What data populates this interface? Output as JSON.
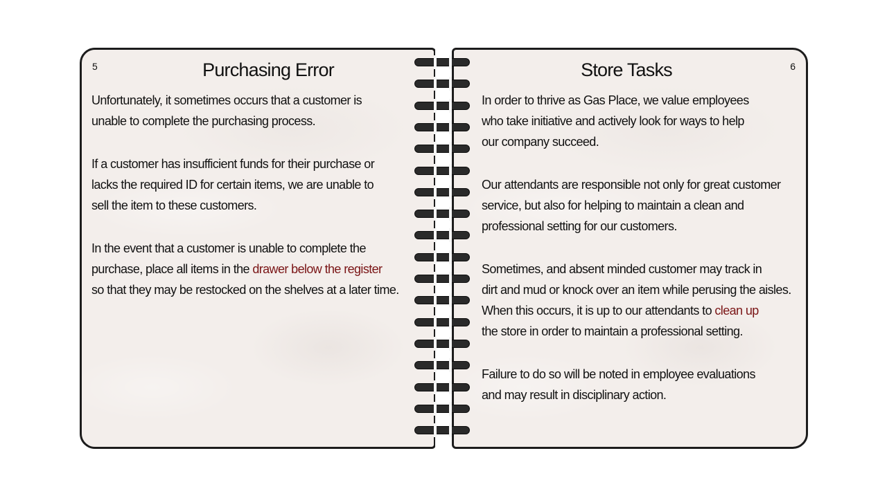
{
  "left_page": {
    "number": "5",
    "title": "Purchasing Error",
    "paragraphs": [
      {
        "lines": [
          "Unfortunately, it sometimes occurs that a customer is",
          "unable to complete the purchasing process."
        ]
      },
      {
        "lines": [
          "If a customer has insufficient funds for their purchase or",
          "lacks the required ID for certain items, we are unable to",
          "sell the item to these customers."
        ]
      },
      {
        "line1": "In the event that a customer is unable to complete the",
        "line2_before": "purchase, place all items in the ",
        "line2_highlight": "drawer below the register",
        "line3": "so that they may be restocked on the shelves at a later time."
      }
    ]
  },
  "right_page": {
    "number": "6",
    "title": "Store Tasks",
    "paragraphs": [
      {
        "lines": [
          "In order to thrive as Gas Place, we value employees",
          "who take initiative and actively look for ways to help",
          "our company succeed."
        ]
      },
      {
        "lines": [
          "Our attendants are responsible not only for great customer",
          "service, but also for helping to maintain a clean and",
          "professional setting for our customers."
        ]
      },
      {
        "line1": "Sometimes, and absent minded customer may track in",
        "line2": "dirt and mud or knock over an item while perusing the aisles.",
        "line3_before": "When this occurs, it is up to our attendants to ",
        "line3_highlight": "clean up",
        "line4": "the store in order to maintain a professional setting."
      },
      {
        "lines": [
          "Failure to do so will be noted in employee evaluations",
          "and may result in disciplinary action."
        ]
      }
    ]
  },
  "colors": {
    "page_background": "#f3eeeb",
    "border": "#1c1c1c",
    "text": "#111111",
    "highlight": "#7a1516",
    "spiral": "#2a2a2a"
  }
}
